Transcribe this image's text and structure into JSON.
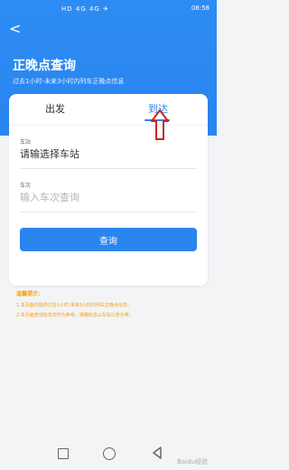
{
  "status": {
    "left": "HD 4G 4G ✈",
    "time": "08:58"
  },
  "header": {
    "back": "<",
    "title": "正晚点查询",
    "subtitle": "过去1小时-未来3小时内列车正晚点信息"
  },
  "tabs": {
    "depart": "出发",
    "arrive": "到达"
  },
  "form": {
    "station_label": "车站",
    "station_value": "请输选择车站",
    "train_label": "车次",
    "train_placeholder": "输入车次查询",
    "query_button": "查询"
  },
  "tips": {
    "title": "温馨提示：",
    "line1": "1.本页面仅提供过去1小时-未来3小时内列车正晚点信息。",
    "line2": "2.本页面查询信息仅作为参考，准确信息以车站公告为准。"
  },
  "watermark": "Baidu经验",
  "colors": {
    "primary": "#2a85ee",
    "tip": "#f59e0b",
    "arrow": "#cc2222"
  }
}
